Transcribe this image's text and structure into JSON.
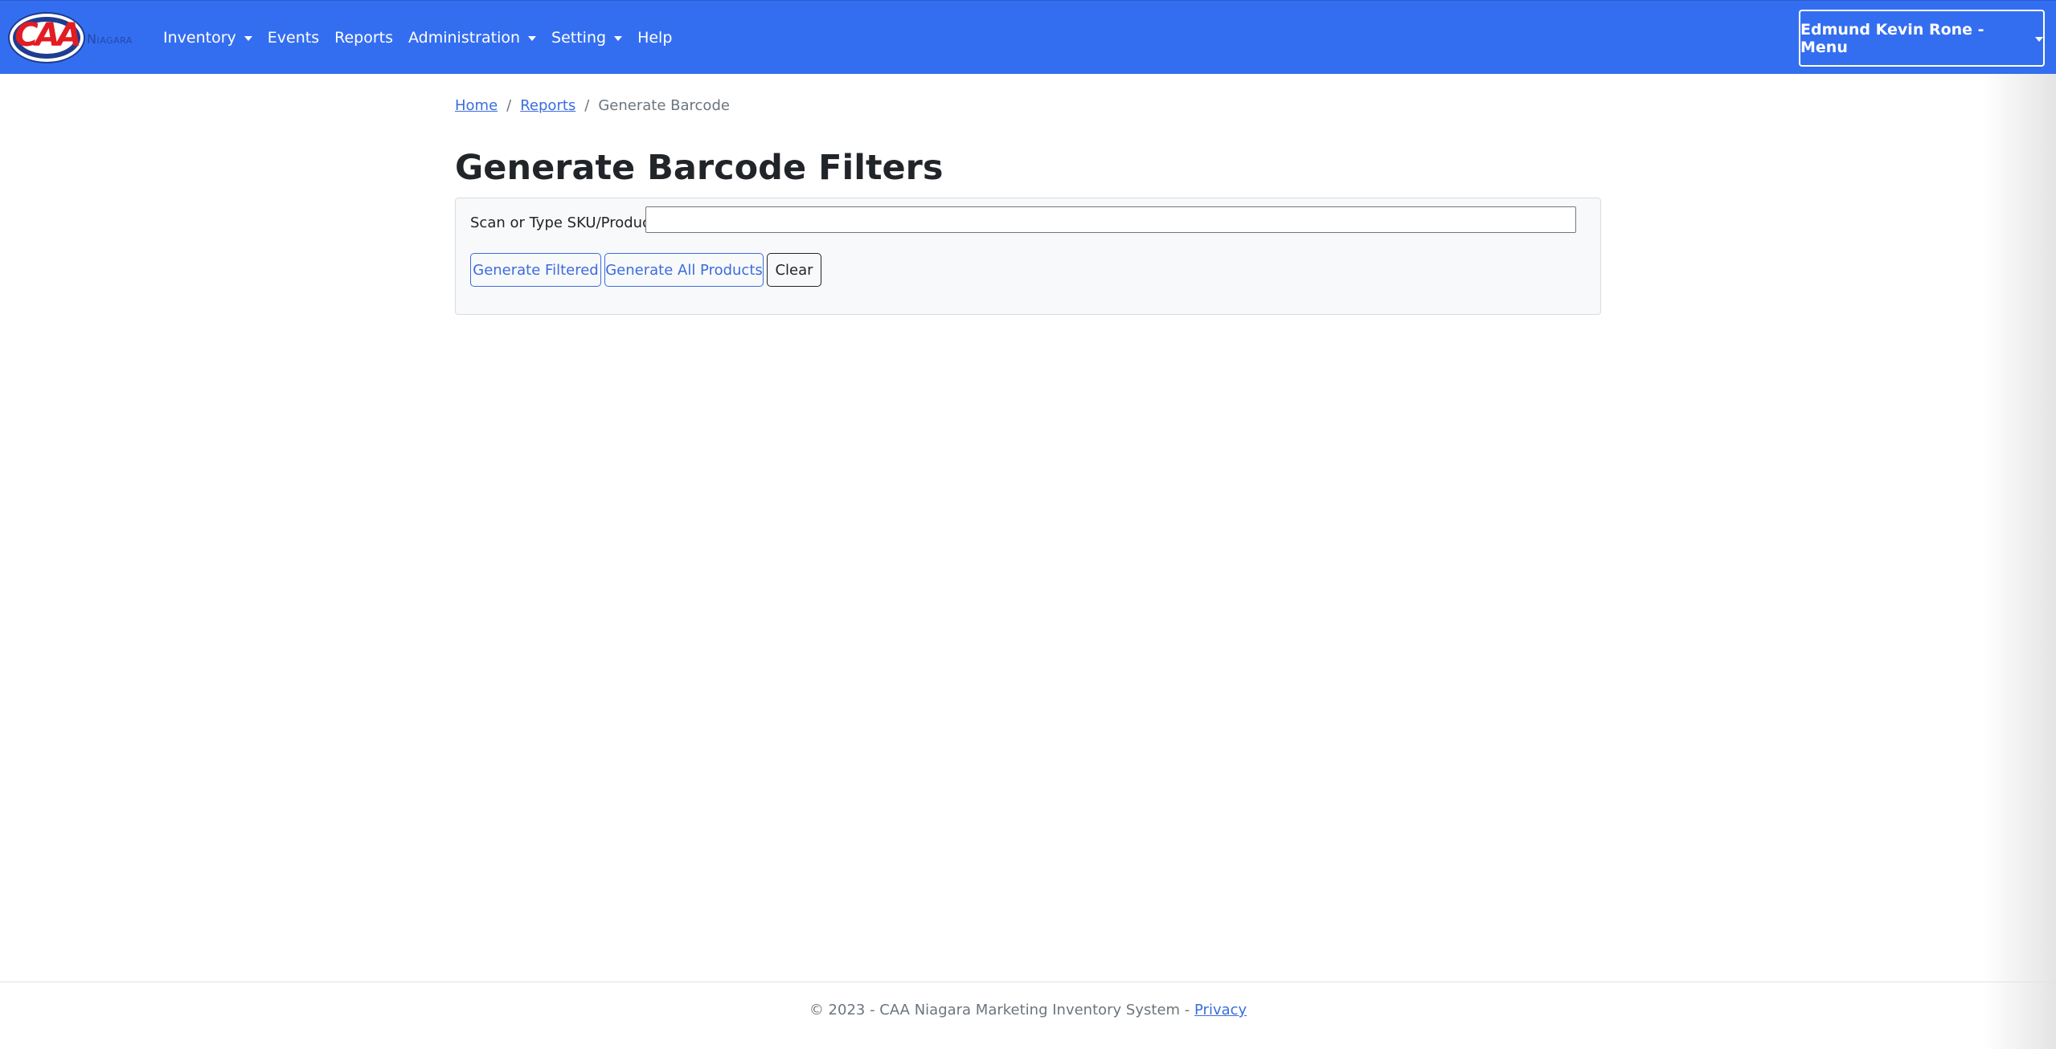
{
  "navbar": {
    "logo_text": "CAA",
    "logo_subtext": "Niagara",
    "items": [
      {
        "label": "Inventory",
        "dropdown": true
      },
      {
        "label": "Events",
        "dropdown": false
      },
      {
        "label": "Reports",
        "dropdown": false
      },
      {
        "label": "Administration",
        "dropdown": true
      },
      {
        "label": "Setting",
        "dropdown": true
      },
      {
        "label": "Help",
        "dropdown": false
      }
    ],
    "user_menu_label": "Edmund Kevin Rone - Menu",
    "background_color": "#346ef0"
  },
  "breadcrumb": {
    "home": "Home",
    "separator": "/",
    "reports": "Reports",
    "current": "Generate Barcode"
  },
  "page": {
    "title": "Generate Barcode Filters"
  },
  "filter": {
    "label": "Scan or Type SKU/Product:",
    "input_value": "",
    "buttons": {
      "generate_filtered": "Generate Filtered",
      "generate_all": "Generate All Products",
      "clear": "Clear"
    }
  },
  "footer": {
    "text": "© 2023 - CAA Niagara Marketing Inventory System - ",
    "privacy_link": "Privacy"
  },
  "colors": {
    "primary": "#3b6ce0",
    "logo_red": "#e31b23",
    "logo_blue": "#1e3d8f"
  }
}
